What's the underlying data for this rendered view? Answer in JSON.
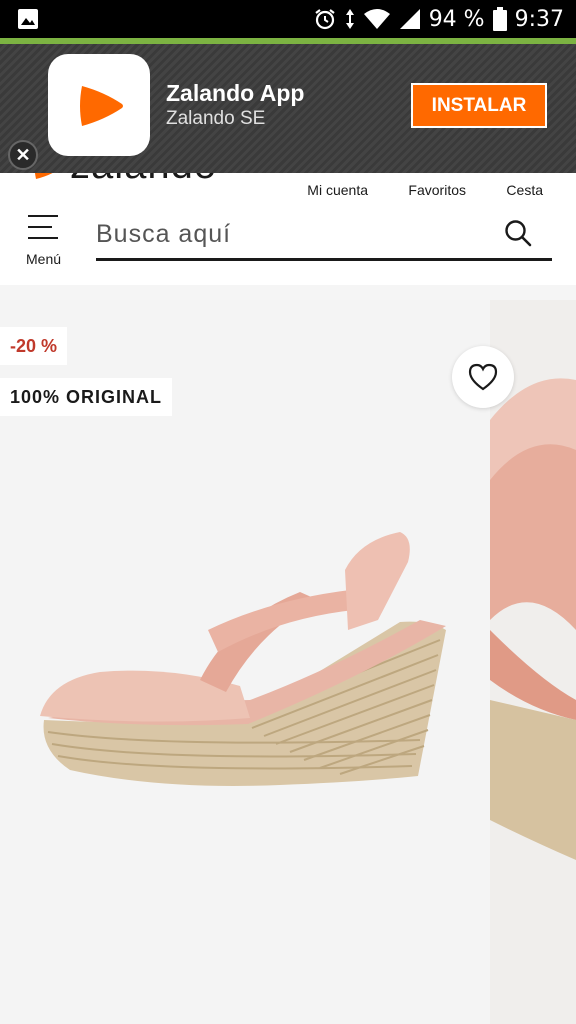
{
  "status_bar": {
    "battery": "94 %",
    "time": "9:37",
    "icons": [
      "image-icon",
      "alarm-icon",
      "data-arrows-icon",
      "wifi-icon",
      "signal-icon",
      "battery-icon"
    ]
  },
  "app_banner": {
    "close_label": "✕",
    "app_name": "Zalando App",
    "publisher": "Zalando SE",
    "install_label": "INSTALAR",
    "accent_color": "#ff6900"
  },
  "header": {
    "logo_text": "zalando",
    "links": [
      "Mi cuenta",
      "Favoritos",
      "Cesta"
    ],
    "menu_label": "Menú",
    "search_placeholder": "Busca aquí"
  },
  "product": {
    "discount_badge": "-20 %",
    "original_badge": "100% ORIGINAL",
    "discount_color": "#c0392b"
  }
}
